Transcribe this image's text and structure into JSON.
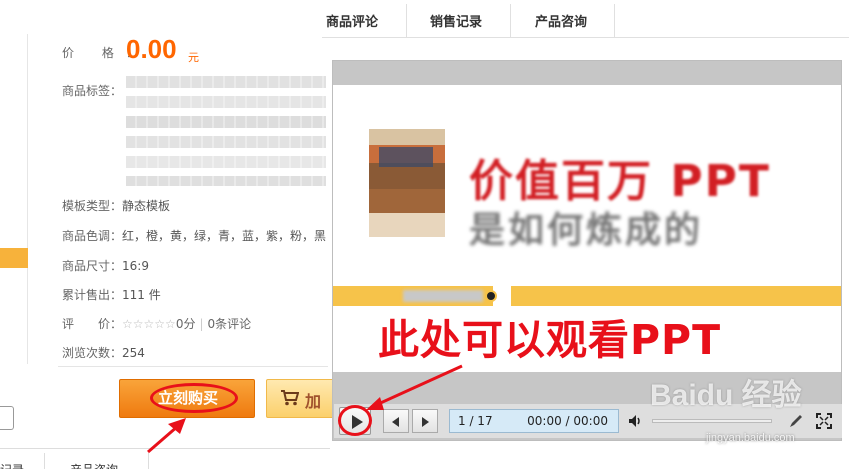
{
  "product": {
    "price_label": "价 格：",
    "price_value": "0.00",
    "price_unit": "元",
    "tags_label": "商品标签：",
    "type_label": "模板类型：",
    "type_value": "静态模板",
    "color_label": "商品色调：",
    "color_value": "红，橙，黄，绿，青，蓝，紫，粉，黑",
    "size_label": "商品尺寸：",
    "size_value": "16:9",
    "sold_label": "累计售出：",
    "sold_value": "111 件",
    "rating_label": "评　　价：",
    "rating_stars": "☆☆☆☆☆",
    "rating_score": "0分",
    "rating_sep": "|",
    "rating_count": "0条评论",
    "views_label": "浏览次数：",
    "views_value": "254"
  },
  "actions": {
    "buy_label": "立刻购买",
    "cart_label": "加"
  },
  "top_tabs": [
    "商品评论",
    "销售记录",
    "产品咨询"
  ],
  "bottom_tabs": [
    "记录",
    "产品咨询"
  ],
  "viewer": {
    "slide_title_line1": "价值百万 PPT",
    "slide_title_line2": "是如何炼成的",
    "page_current": "1 / 17",
    "time": "00:00 / 00:00"
  },
  "annotation": {
    "text": "此处可以观看PPT",
    "color": "#e8101a"
  },
  "watermark": {
    "brand": "Baidu 经验",
    "url": "jingyan.baidu.com"
  },
  "colors": {
    "price": "#ff6600",
    "buy_button": "#f18a1f",
    "slide_band": "#f6c34a",
    "highlight": "#e8101a"
  }
}
